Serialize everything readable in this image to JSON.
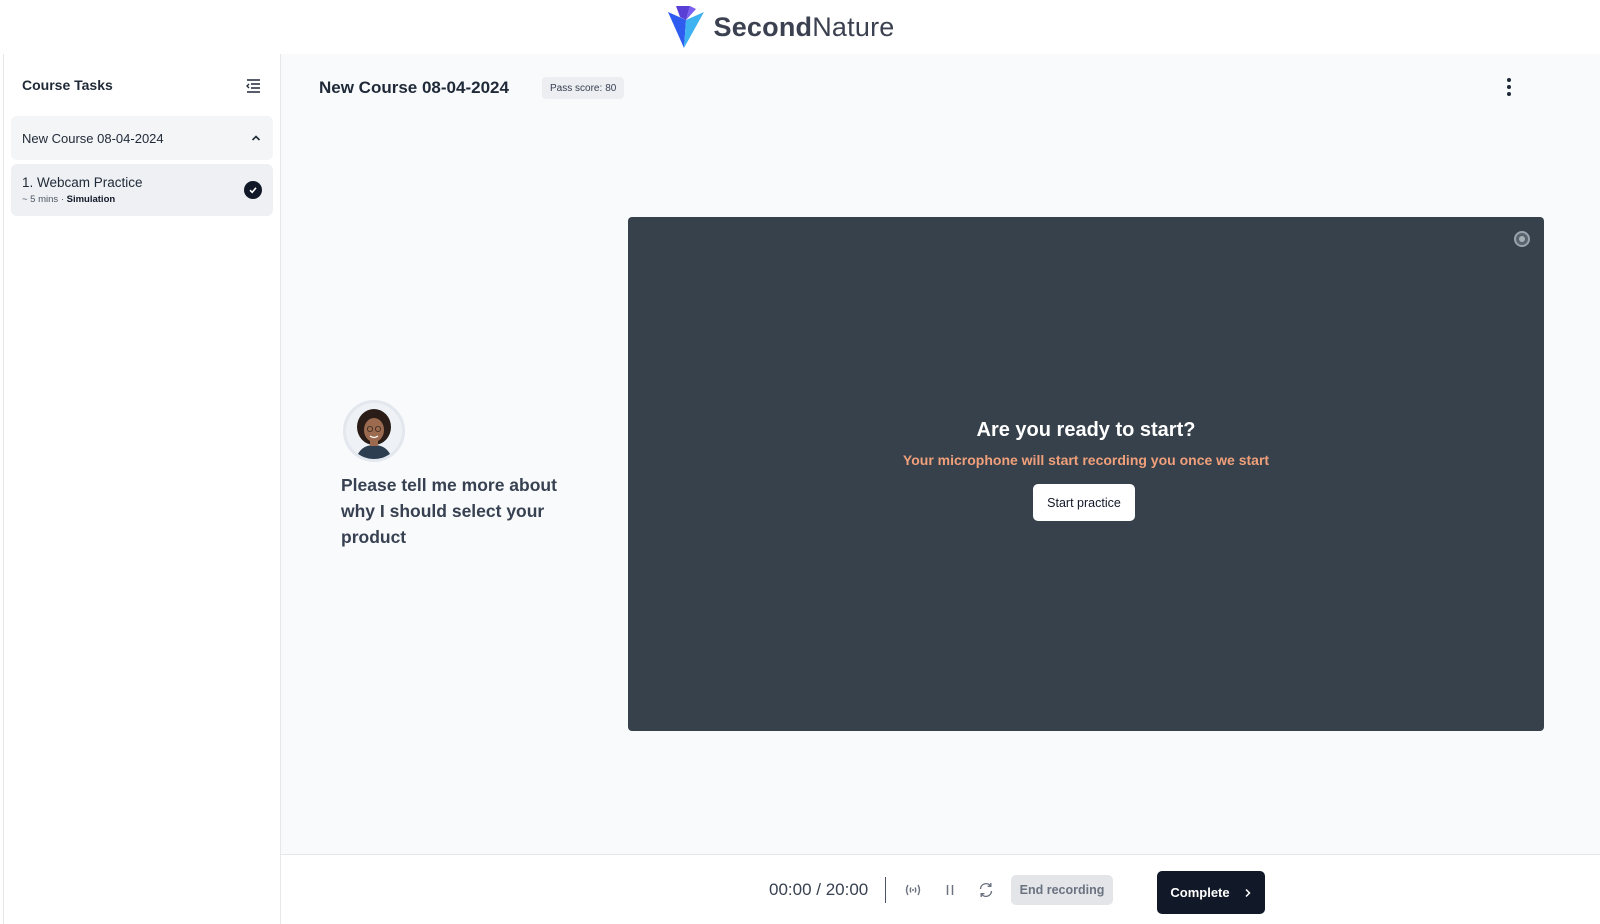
{
  "brand": {
    "name_bold": "Second",
    "name_regular": "Nature",
    "colors": {
      "logo_primary": "#2e5cf0",
      "logo_secondary": "#3fb2f2",
      "logo_deep": "#5a3fd6"
    }
  },
  "sidebar": {
    "title": "Course Tasks",
    "course_group": {
      "label": "New Course 08-04-2024",
      "expanded": true
    },
    "tasks": [
      {
        "title": "1. Webcam Practice",
        "duration": "~ 5 mins",
        "separator": "·",
        "type": "Simulation",
        "completed": true
      }
    ]
  },
  "main": {
    "title": "New Course 08-04-2024",
    "pass_score_label": "Pass score:",
    "pass_score_value": "80",
    "prompt": "Please tell me more about why I should select your product",
    "video": {
      "heading": "Are you ready to start?",
      "subheading": "Your microphone will start recording you once we start",
      "start_label": "Start practice",
      "colors": {
        "panel": "#36414c",
        "subheading": "#f0a07a"
      }
    }
  },
  "bottom": {
    "timer": "00:00 / 20:00",
    "end_label": "End recording",
    "complete_label": "Complete"
  }
}
